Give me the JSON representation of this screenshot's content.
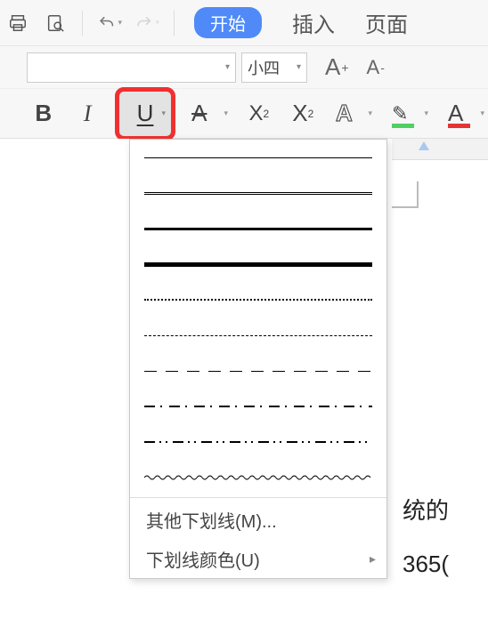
{
  "top_icons": {
    "print": "print-icon",
    "preview": "print-preview-icon",
    "undo": "undo-icon",
    "redo": "redo-icon"
  },
  "tabs": {
    "start": "开始",
    "insert": "插入",
    "page": "页面"
  },
  "font": {
    "name": "",
    "size_label": "小四"
  },
  "format": {
    "bold": "B",
    "italic": "I",
    "underline": "U",
    "strike": "A",
    "superscript": "X",
    "superscript_num": "2",
    "subscript": "X",
    "subscript_num": "2",
    "texteffects": "A",
    "highlight_pen": "✎",
    "font_color": "A",
    "grow_font": "A",
    "grow_plus": "+",
    "shrink_font": "A",
    "shrink_minus": "-"
  },
  "underline_menu": {
    "more": "其他下划线(M)...",
    "color": "下划线颜色(U)"
  },
  "document": {
    "line1": "统的",
    "line2": "365("
  }
}
